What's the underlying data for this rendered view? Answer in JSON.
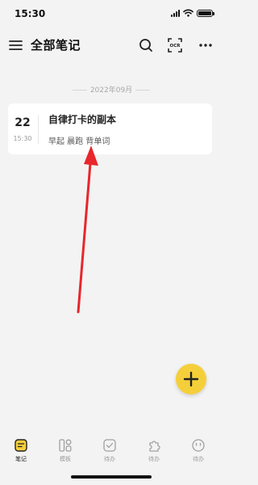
{
  "status_bar": {
    "time": "15:30"
  },
  "header": {
    "title": "全部笔记",
    "menu_icon": "hamburger-menu-icon",
    "search_icon": "search-icon",
    "ocr_icon": "ocr-scan-icon",
    "ocr_label": "OCR",
    "more_icon": "more-dots-icon"
  },
  "date_group": {
    "label": "2022年09月"
  },
  "notes": [
    {
      "day": "22",
      "time": "15:30",
      "title": "自律打卡的副本",
      "preview": "早起 晨跑 背单词"
    }
  ],
  "fab": {
    "icon": "plus-icon"
  },
  "tabbar": {
    "tabs": [
      {
        "label": "笔记",
        "icon": "note-icon",
        "active": true
      },
      {
        "label": "模板",
        "icon": "template-grid-icon",
        "active": false
      },
      {
        "label": "待办",
        "icon": "checkbox-icon",
        "active": false
      },
      {
        "label": "待办",
        "icon": "puzzle-icon",
        "active": false
      },
      {
        "label": "待办",
        "icon": "smile-icon",
        "active": false
      }
    ]
  },
  "colors": {
    "background": "#f3f3f3",
    "card": "#ffffff",
    "accent_yellow": "#f5cf3a",
    "annotation_red": "#e8262b"
  }
}
